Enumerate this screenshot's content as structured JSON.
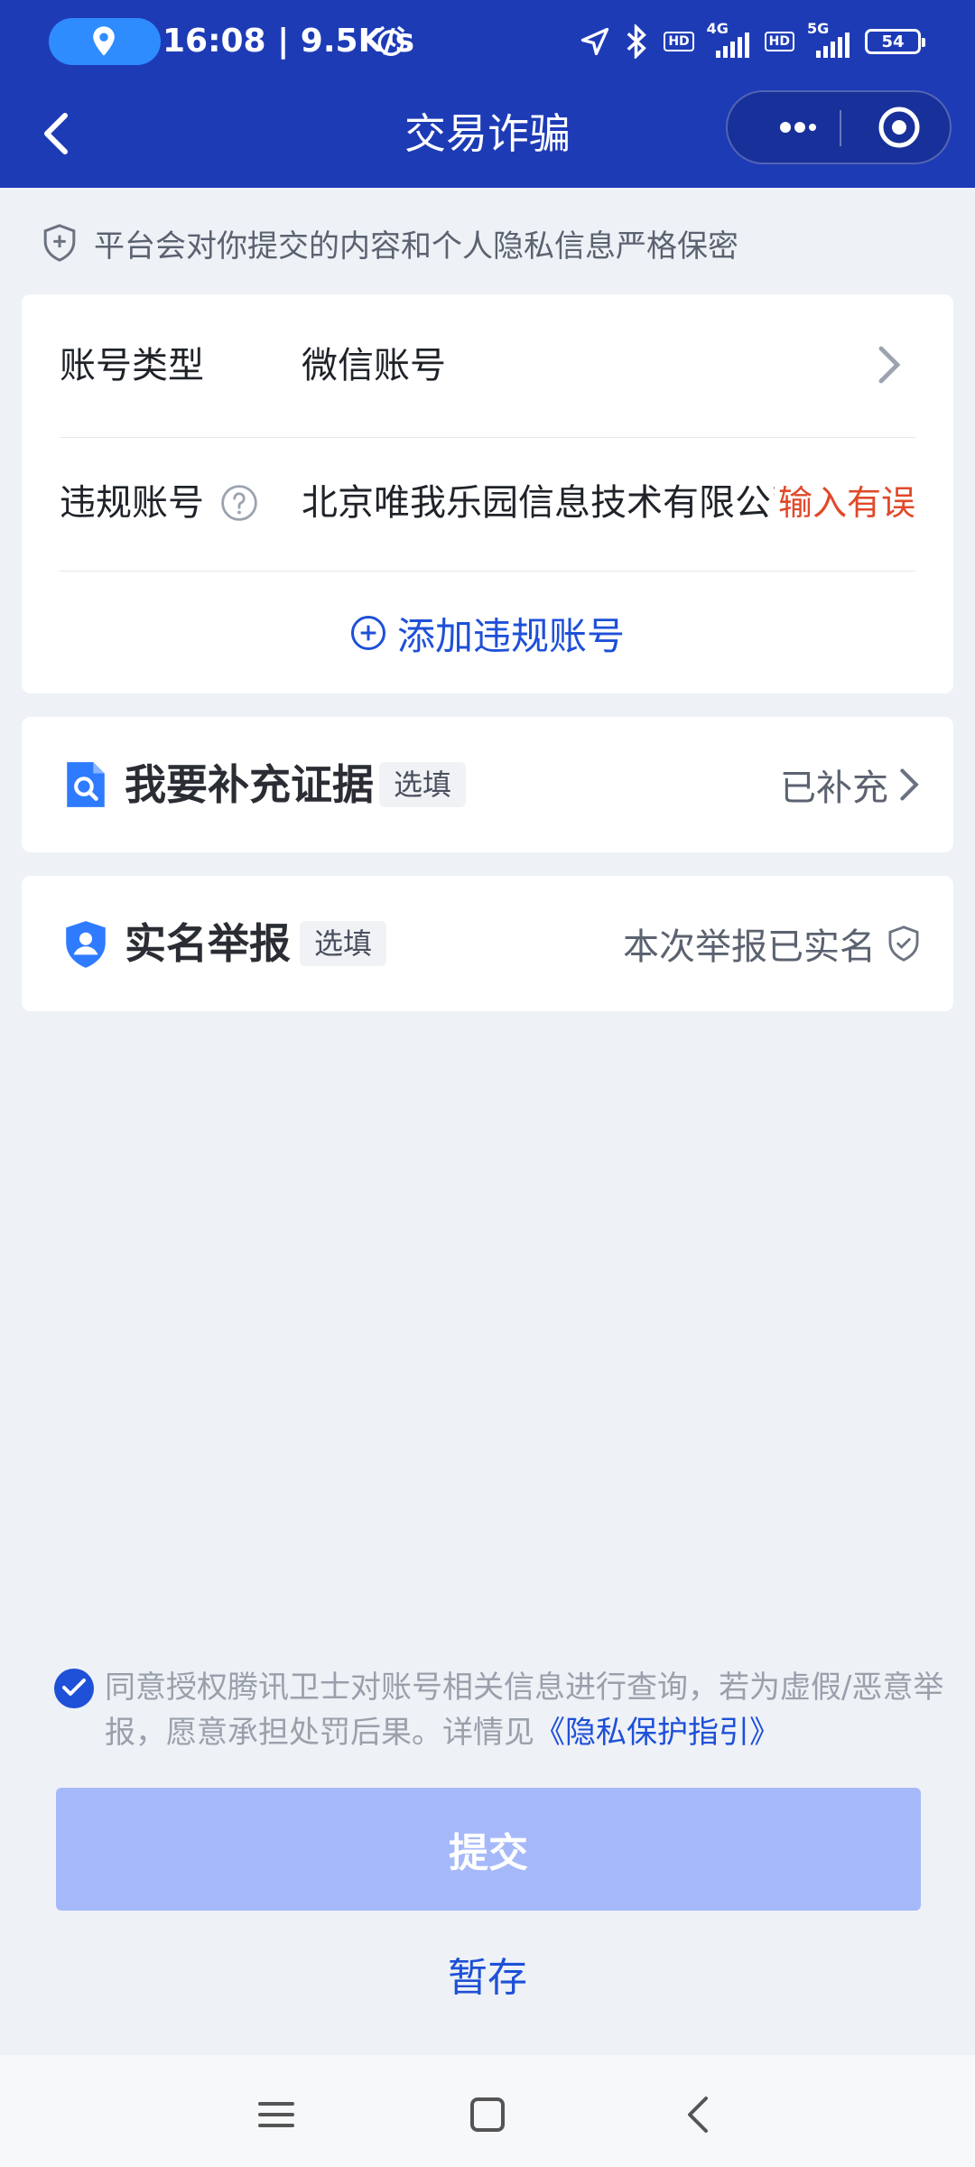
{
  "status_bar": {
    "time_speed": "16:08 | 9.5K/s",
    "net1_label": "4G",
    "net2_label": "5G",
    "hd_label": "HD",
    "battery": "54",
    "icons": [
      "location-icon",
      "alarm-icon",
      "navigation-icon",
      "bluetooth-icon",
      "signal-icon",
      "battery-icon"
    ]
  },
  "header": {
    "title": "交易诈骗",
    "icons": [
      "back-arrow-icon",
      "more-dots-icon",
      "close-target-icon"
    ],
    "bg_color": "#1e3bb6"
  },
  "notice": {
    "text": "平台会对你提交的内容和个人隐私信息严格保密"
  },
  "form": {
    "account_type_label": "账号类型",
    "account_type_value": "微信账号",
    "violation_label": "违规账号",
    "violation_value": "北京唯我乐园信息技术有限公司",
    "violation_error": "输入有误",
    "add_label": "添加违规账号"
  },
  "evidence": {
    "title": "我要补充证据",
    "tag": "选填",
    "status": "已补充"
  },
  "realname": {
    "title": "实名举报",
    "tag": "选填",
    "status": "本次举报已实名"
  },
  "agreement": {
    "text": "同意授权腾讯卫士对账号相关信息进行查询，若为虚假/恶意举报，愿意承担处罚后果。详情见",
    "link": "《隐私保护指引》",
    "checked": true
  },
  "actions": {
    "submit": "提交",
    "save": "暂存"
  },
  "colors": {
    "accent": "#1e50d8",
    "error": "#e0492a",
    "submit_disabled": "#a5b9fa"
  }
}
